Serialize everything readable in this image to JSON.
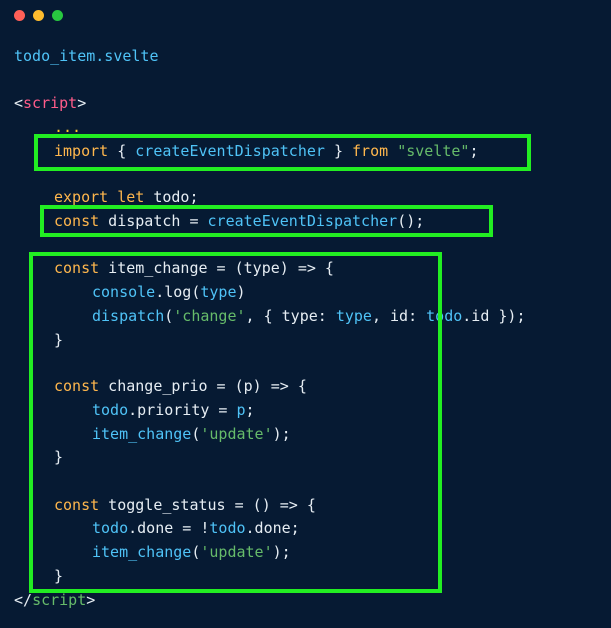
{
  "window": {
    "controls": [
      "close",
      "minimize",
      "maximize"
    ]
  },
  "file": {
    "name": "todo_item.svelte"
  },
  "code": {
    "script_open_bracket": "<",
    "script_tag": "script",
    "script_close_bracket": ">",
    "ellipsis": "...",
    "import_kw": "import",
    "import_brace_open": " { ",
    "import_name": "createEventDispatcher",
    "import_brace_close": " } ",
    "from_kw": "from",
    "import_source": "\"svelte\"",
    "semicolon": ";",
    "export_kw": "export",
    "let_kw": "let",
    "todo_decl": " todo;",
    "const_kw": "const",
    "dispatch_decl": " dispatch = ",
    "dispatcher_call": "createEventDispatcher",
    "call_end": "();",
    "item_change_decl": " item_change = (type) => {",
    "console": "console",
    "log_call": ".log(",
    "type": "type",
    "close_paren": ")",
    "dispatch": "dispatch",
    "open_paren": "(",
    "change_str": "'change'",
    "dispatch_obj_start": ", { type: ",
    "dispatch_obj_mid": ", id: ",
    "todo": "todo",
    "dot_id": ".id });",
    "close_brace": "}",
    "change_prio_decl": " change_prio = (p) => {",
    "priority_prop": ".priority = ",
    "p": "p",
    "item_change": "item_change",
    "update_str": "'update'",
    "call_close": ");",
    "toggle_status_decl": " toggle_status = () => {",
    "done_assign": ".done = !",
    "done_end": ".done;",
    "script_end_open": "</",
    "script_end_tag": "script",
    "script_end_close": ">"
  },
  "highlight_color": "#22ee22"
}
